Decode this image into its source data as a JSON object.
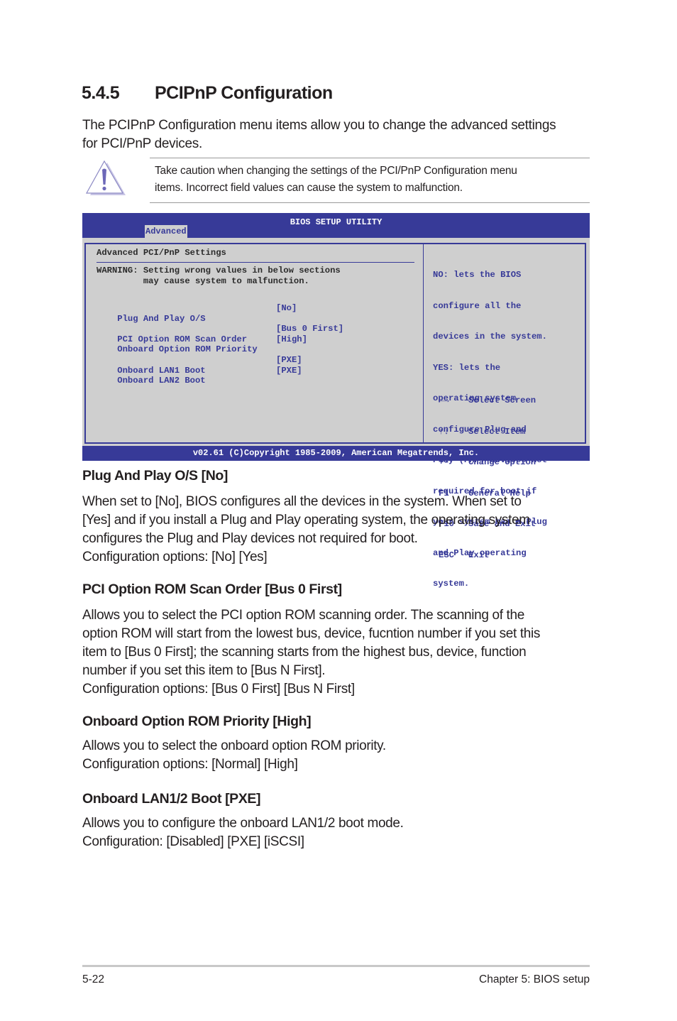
{
  "section": {
    "number": "5.4.5",
    "title": "PCIPnP Configuration",
    "intro_lines": [
      "The PCIPnP Configuration menu items allow you to change the advanced settings",
      "for PCI/PnP devices."
    ]
  },
  "note": {
    "icon": "warning-triangle-icon",
    "lines": [
      "Take caution when changing the settings of the PCI/PnP Configuration menu",
      "items. Incorrect field values can cause the system to malfunction."
    ]
  },
  "bios": {
    "title": "BIOS SETUP UTILITY",
    "active_tab": "Advanced",
    "panel_title": "Advanced PCI/PnP Settings",
    "warning_lines": [
      "WARNING: Setting wrong values in below sections",
      "         may cause system to malfunction."
    ],
    "items": [
      {
        "label": "Plug And Play O/S",
        "value": "[No]"
      },
      {
        "label": "PCI Option ROM Scan Order",
        "value": "[Bus 0 First]"
      },
      {
        "label": "Onboard Option ROM Priority",
        "value": "[High]"
      },
      {
        "label": "Onboard LAN1 Boot",
        "value": "[PXE]"
      },
      {
        "label": "Onboard LAN2 Boot",
        "value": "[PXE]"
      }
    ],
    "help_lines": [
      "NO: lets the BIOS",
      "configure all the",
      "devices in the system.",
      "YES: lets the",
      "operating system",
      "configure Plug and",
      "Play (PnP) devices not",
      "required for boot if",
      "your system has a Plug",
      "and Play operating",
      "system."
    ],
    "keys": [
      {
        "key": "←→",
        "action": "Select Screen"
      },
      {
        "key": "↑↓",
        "action": "Select Item"
      },
      {
        "key": "+-",
        "action": "Change Option"
      },
      {
        "key": "F1",
        "action": "General Help"
      },
      {
        "key": "F10",
        "action": "Save and Exit"
      },
      {
        "key": "ESC",
        "action": "Exit"
      }
    ],
    "copyright": "v02.61 (C)Copyright 1985-2009, American Megatrends, Inc.",
    "colors": {
      "accent": "#373a98",
      "background": "#cfcfcf"
    }
  },
  "subsections": [
    {
      "heading": "Plug And Play O/S [No]",
      "lines": [
        "When set to [No], BIOS configures all the devices in the system. When set to",
        "[Yes] and if you install a Plug and Play operating system, the operating system",
        "configures the Plug and Play devices not required for boot.",
        "Configuration options: [No] [Yes]"
      ]
    },
    {
      "heading": "PCI Option ROM Scan Order [Bus 0 First]",
      "lines": [
        "Allows you to select the PCI option ROM scanning order. The scanning of the",
        "option ROM will start from the lowest bus, device, fucntion number if you set this",
        "item to [Bus 0 First]; the scanning starts from the highest bus, device, function",
        "number if you set this item to [Bus N First].",
        "Configuration options: [Bus 0 First] [Bus N First]"
      ]
    },
    {
      "heading": "Onboard Option ROM Priority [High]",
      "lines": [
        "Allows you to select the onboard option ROM priority.",
        "Configuration options: [Normal] [High]"
      ]
    },
    {
      "heading": "Onboard LAN1/2 Boot [PXE]",
      "lines": [
        "Allows you to configure the onboard LAN1/2 boot mode.",
        "Configuration: [Disabled] [PXE] [iSCSI]"
      ]
    }
  ],
  "footer": {
    "page_number": "5-22",
    "chapter": "Chapter 5: BIOS setup"
  }
}
